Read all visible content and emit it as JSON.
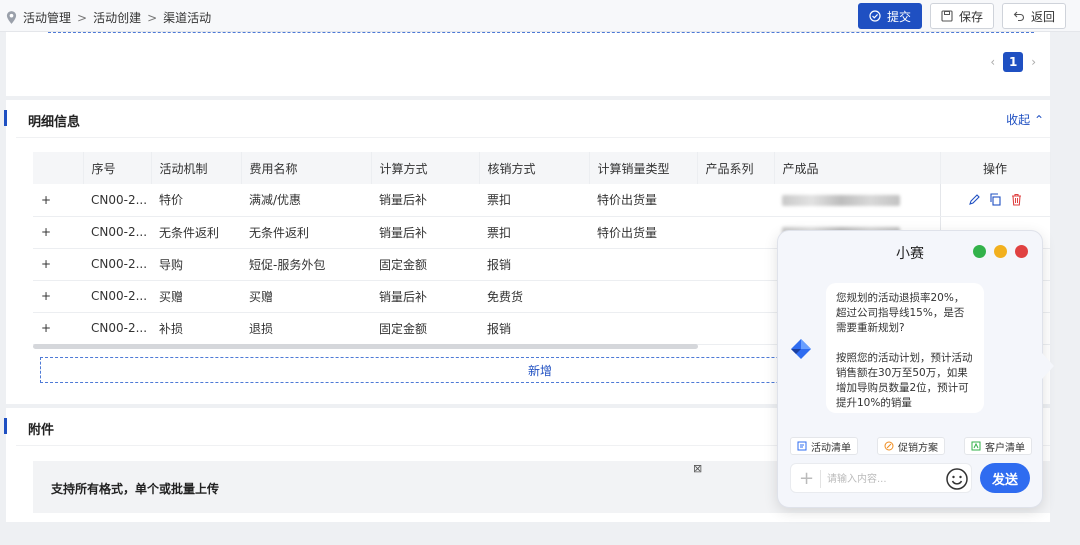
{
  "breadcrumb": {
    "items": [
      "活动管理",
      "活动创建",
      "渠道活动"
    ],
    "separator": ">"
  },
  "toolbar": {
    "submit_label": "提交",
    "save_label": "保存",
    "back_label": "返回"
  },
  "pagination": {
    "current_page": "1"
  },
  "detail": {
    "title": "明细信息",
    "collapse_label": "收起",
    "columns": [
      "序号",
      "活动机制",
      "费用名称",
      "计算方式",
      "核销方式",
      "计算销量类型",
      "产品系列",
      "产成品",
      "操作"
    ],
    "rows": [
      {
        "expand": "+",
        "seq": "CN00-2...",
        "mechanism": "特价",
        "fee_name": "满减/优惠",
        "calc": "销量后补",
        "writeoff": "票扣",
        "sales_type": "特价出货量",
        "series": "",
        "product": ""
      },
      {
        "expand": "+",
        "seq": "CN00-2...",
        "mechanism": "无条件返利",
        "fee_name": "无条件返利",
        "calc": "销量后补",
        "writeoff": "票扣",
        "sales_type": "特价出货量",
        "series": "",
        "product": ""
      },
      {
        "expand": "+",
        "seq": "CN00-2...",
        "mechanism": "导购",
        "fee_name": "短促-服务外包",
        "calc": "固定金额",
        "writeoff": "报销",
        "sales_type": "",
        "series": "",
        "product": ""
      },
      {
        "expand": "+",
        "seq": "CN00-2...",
        "mechanism": "买赠",
        "fee_name": "买赠",
        "calc": "销量后补",
        "writeoff": "免费货",
        "sales_type": "",
        "series": "",
        "product": ""
      },
      {
        "expand": "+",
        "seq": "CN00-2...",
        "mechanism": "补损",
        "fee_name": "退损",
        "calc": "固定金额",
        "writeoff": "报销",
        "sales_type": "",
        "series": "",
        "product": ""
      }
    ],
    "add_label": "新增"
  },
  "attachment": {
    "title": "附件",
    "upload_hint": "支持所有格式，单个或批量上传",
    "tiny_glyph": "⊠"
  },
  "chat": {
    "title": "小赛",
    "message_1": "您规划的活动退损率20%，超过公司指导线15%，是否需要重新规划?",
    "message_2": "按照您的活动计划，预计活动销售额在30万至50万，如果增加导购员数量2位，预计可提升10%的销量",
    "quick_actions": [
      "活动清单",
      "促销方案",
      "客户清单"
    ],
    "input_placeholder": "请输入内容...",
    "send_label": "发送"
  },
  "colors": {
    "primary": "#1f50c2",
    "send": "#2f6cf0",
    "delete": "#e04141"
  }
}
